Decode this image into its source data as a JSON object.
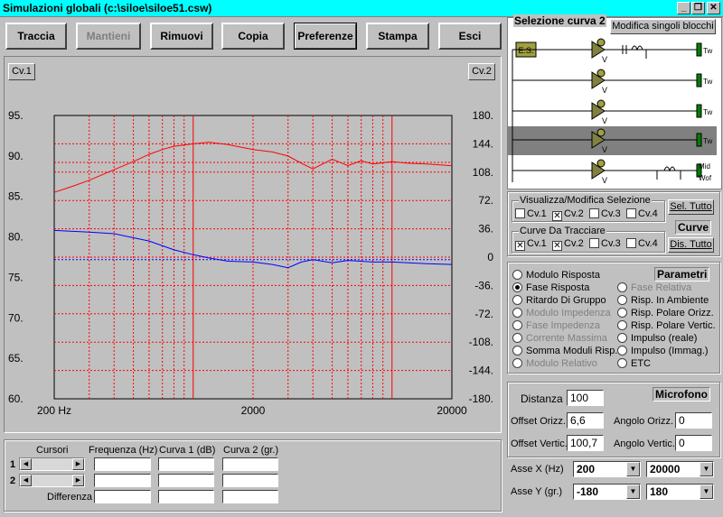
{
  "window": {
    "title": "Simulazioni globali (c:\\siloe\\siloe51.csw)"
  },
  "toolbar": {
    "traccia": "Traccia",
    "mantieni": "Mantieni",
    "rimuovi": "Rimuovi",
    "copia": "Copia",
    "preferenze": "Preferenze",
    "stampa": "Stampa",
    "esci": "Esci"
  },
  "plot": {
    "cv1_button": "Cv.1",
    "cv2_button": "Cv.2",
    "left_ticks": [
      "95.",
      "90.",
      "85.",
      "80.",
      "75.",
      "70.",
      "65.",
      "60."
    ],
    "right_ticks": [
      "180.",
      "144.",
      "108.",
      "72.",
      "36.",
      "0",
      "-36.",
      "-72.",
      "-108.",
      "-144.",
      "-180."
    ],
    "x_labels": [
      "200 Hz",
      "2000",
      "20000"
    ]
  },
  "chart_data": {
    "type": "line",
    "x_scale": "log",
    "xlim": [
      200,
      20000
    ],
    "ylim_left": [
      60,
      95
    ],
    "ylim_right": [
      -180,
      180
    ],
    "grid": true,
    "series": [
      {
        "axis": "left",
        "color": "#ff0000",
        "x": [
          200,
          250,
          300,
          400,
          500,
          600,
          700,
          800,
          1000,
          1200,
          1500,
          2000,
          2500,
          3000,
          3500,
          4000,
          5000,
          6000,
          7000,
          8000,
          10000,
          12000,
          15000,
          20000
        ],
        "y": [
          85.5,
          86.3,
          87.0,
          88.3,
          89.3,
          90.2,
          90.8,
          91.2,
          91.5,
          91.7,
          91.4,
          90.8,
          90.5,
          90.0,
          89.1,
          88.4,
          89.6,
          88.8,
          89.4,
          89.0,
          89.3,
          89.1,
          89.0,
          88.8
        ]
      },
      {
        "axis": "left",
        "color": "#ff0000",
        "dashed": true,
        "x": [
          200,
          20000
        ],
        "y": [
          89.2,
          89.2
        ]
      },
      {
        "axis": "left",
        "color": "#0000ff",
        "x": [
          200,
          300,
          400,
          500,
          600,
          700,
          800,
          1000,
          1200,
          1500,
          2000,
          2500,
          3000,
          3500,
          4000,
          5000,
          6000,
          8000,
          10000,
          15000,
          20000
        ],
        "y": [
          80.8,
          80.6,
          80.4,
          79.9,
          79.5,
          78.9,
          78.4,
          77.8,
          77.4,
          77.0,
          76.9,
          76.6,
          76.2,
          76.9,
          77.2,
          76.8,
          77.1,
          76.9,
          76.9,
          76.7,
          76.6
        ]
      },
      {
        "axis": "left",
        "color": "#0000ff",
        "dashed": true,
        "x": [
          200,
          20000
        ],
        "y": [
          77.2,
          77.2
        ]
      }
    ]
  },
  "schematic": {
    "title": "Selezione curva 2",
    "modify_button": "Modifica singoli blocchi",
    "es_label": "E.S.",
    "tw": "Tw",
    "mid": "Mid",
    "wof": "Wof"
  },
  "visualize": {
    "title": "Visualizza/Modifica Selezione",
    "items": [
      "Cv.1",
      "Cv.2",
      "Cv.3",
      "Cv.4"
    ],
    "checked": [
      false,
      true,
      false,
      false
    ],
    "sel_all": "Sel. Tutto"
  },
  "curves": {
    "title": "Curve Da Tracciare",
    "items": [
      "Cv.1",
      "Cv.2",
      "Cv.3",
      "Cv.4"
    ],
    "checked": [
      true,
      true,
      false,
      false
    ],
    "badge": "Curve",
    "dis_all": "Dis. Tutto"
  },
  "params": {
    "badge": "Parametri",
    "left": [
      {
        "label": "Modulo Risposta",
        "on": false,
        "dim": false
      },
      {
        "label": "Fase Risposta",
        "on": true,
        "dim": false
      },
      {
        "label": "Ritardo Di Gruppo",
        "on": false,
        "dim": false
      },
      {
        "label": "Modulo Impedenza",
        "on": false,
        "dim": true
      },
      {
        "label": "Fase Impedenza",
        "on": false,
        "dim": true
      },
      {
        "label": "Corrente Massima",
        "on": false,
        "dim": true
      },
      {
        "label": "Somma Moduli Risp.",
        "on": false,
        "dim": false
      },
      {
        "label": "Modulo Relativo",
        "on": false,
        "dim": true
      }
    ],
    "right": [
      {
        "label": "Fase Relativa",
        "on": false,
        "dim": true
      },
      {
        "label": "Risp. In Ambiente",
        "on": false,
        "dim": false
      },
      {
        "label": "Risp. Polare Orizz.",
        "on": false,
        "dim": false
      },
      {
        "label": "Risp. Polare Vertic.",
        "on": false,
        "dim": false
      },
      {
        "label": "Impulso (reale)",
        "on": false,
        "dim": false
      },
      {
        "label": "Impulso (Immag.)",
        "on": false,
        "dim": false
      },
      {
        "label": "ETC",
        "on": false,
        "dim": false
      }
    ]
  },
  "microfono": {
    "badge": "Microfono",
    "distanza_label": "Distanza",
    "distanza": "100",
    "offset_orizz_label": "Offset Orizz.",
    "offset_orizz": "6,6",
    "offset_vertic_label": "Offset Vertic.",
    "offset_vertic": "100,7",
    "angolo_orizz_label": "Angolo Orizz.",
    "angolo_orizz": "0",
    "angolo_vertic_label": "Angolo Vertic.",
    "angolo_vertic": "0"
  },
  "axes": {
    "asse_x_label": "Asse X",
    "asse_x_unit": "(Hz)",
    "asse_x_min": "200",
    "asse_x_max": "20000",
    "asse_y_label": "Asse Y",
    "asse_y_unit": "(gr.)",
    "asse_y_min": "-180",
    "asse_y_max": "180"
  },
  "cursors": {
    "cursori": "Cursori",
    "frequenza": "Frequenza (Hz)",
    "curva1": "Curva 1 (dB)",
    "curva2": "Curva 2 (gr.)",
    "row1": "1",
    "row2": "2",
    "differenza": "Differenza"
  }
}
